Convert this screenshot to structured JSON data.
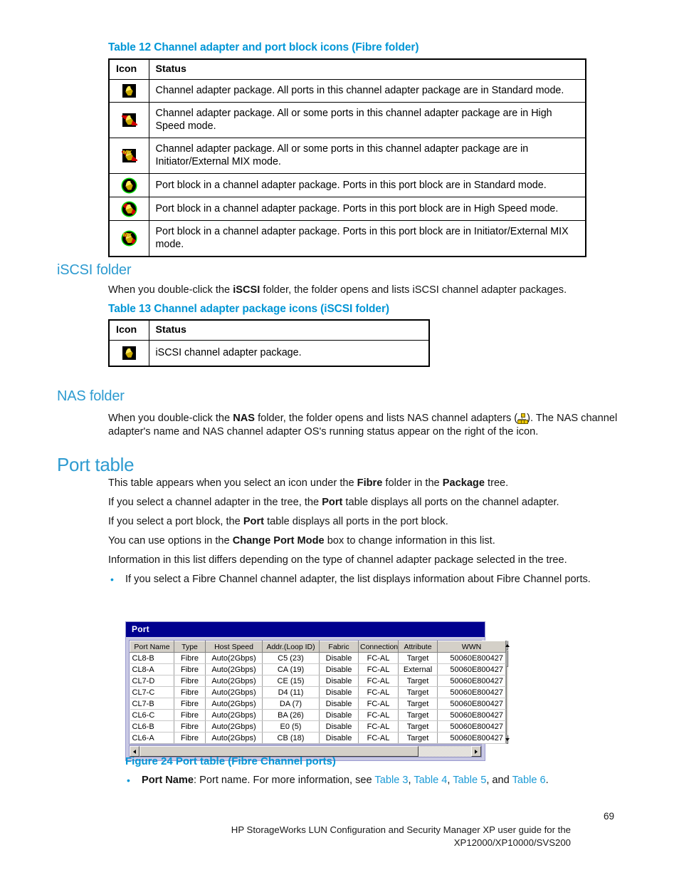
{
  "page": {
    "number": "69",
    "footer_line1": "HP StorageWorks LUN Configuration and Security Manager XP user guide for the",
    "footer_line2": "XP12000/XP10000/SVS200"
  },
  "table12": {
    "caption": "Table 12 Channel adapter and port block icons (Fibre folder)",
    "headers": [
      "Icon",
      "Status"
    ],
    "rows": [
      {
        "icon": "channel-adapter-standard-icon",
        "status": "Channel adapter package.  All ports in this channel adapter package are in Standard mode."
      },
      {
        "icon": "channel-adapter-highspeed-icon",
        "status": "Channel adapter package.  All or some ports in this channel adapter package are in High Speed mode."
      },
      {
        "icon": "channel-adapter-mix-icon",
        "status": "Channel adapter package.  All or some ports in this channel adapter package are in Initiator/External MIX mode."
      },
      {
        "icon": "port-block-standard-icon",
        "status": "Port block in a channel adapter package.  Ports in this port block are in Standard mode."
      },
      {
        "icon": "port-block-highspeed-icon",
        "status": "Port block in a channel adapter package.  Ports in this port block are in High Speed mode."
      },
      {
        "icon": "port-block-mix-icon",
        "status": "Port block in a channel adapter package.  Ports in this port block are in Initiator/External MIX mode."
      }
    ]
  },
  "iscsi_section": {
    "heading": "iSCSI folder",
    "intro_a": "When you double-click the ",
    "intro_b": "iSCSI",
    "intro_c": " folder, the folder opens and lists iSCSI channel adapter packages."
  },
  "table13": {
    "caption_a": "Table 13 Channel adapter package icons (",
    "caption_b": "iSCSI",
    "caption_c": " folder)",
    "headers": [
      "Icon",
      "Status"
    ],
    "rows": [
      {
        "icon": "iscsi-channel-adapter-icon",
        "status": "iSCSI channel adapter package."
      }
    ]
  },
  "nas_section": {
    "heading": "NAS folder",
    "line1_a": "When you double-click the ",
    "line1_b": "NAS",
    "line1_c": " folder, the folder opens and lists NAS channel adapters (",
    "line1_d": "). The NAS",
    "line2": "channel adapter's name and NAS channel adapter OS's running status appear on the right of the icon."
  },
  "port_table_section": {
    "heading": "Port table",
    "paragraphs": [
      {
        "parts": [
          {
            "t": "This table appears when you select an icon under the ",
            "b": false
          },
          {
            "t": "Fibre",
            "b": true
          },
          {
            "t": " folder in the ",
            "b": false
          },
          {
            "t": "Package",
            "b": true
          },
          {
            "t": " tree.",
            "b": false
          }
        ]
      },
      {
        "parts": [
          {
            "t": "If you select a channel adapter in the tree, the ",
            "b": false
          },
          {
            "t": "Port",
            "b": true
          },
          {
            "t": " table displays all ports on the channel adapter.",
            "b": false
          }
        ]
      },
      {
        "parts": [
          {
            "t": "If you select a port block, the ",
            "b": false
          },
          {
            "t": "Port",
            "b": true
          },
          {
            "t": " table displays all ports in the port block.",
            "b": false
          }
        ]
      },
      {
        "parts": [
          {
            "t": "You can use options in the ",
            "b": false
          },
          {
            "t": "Change Port Mode",
            "b": true
          },
          {
            "t": " box to change information in this list.",
            "b": false
          }
        ]
      },
      {
        "parts": [
          {
            "t": "Information in this list differs depending on the type of channel adapter package selected in the tree.",
            "b": false
          }
        ]
      }
    ],
    "bullet1_line1": "If you select a Fibre Channel channel adapter, the list displays information about Fibre Channel",
    "bullet1_line2": "ports."
  },
  "port_window": {
    "title": "Port",
    "columns": [
      "Port Name",
      "Type",
      "Host Speed",
      "Addr.(Loop ID)",
      "Fabric",
      "Connection",
      "Attribute",
      "WWN"
    ],
    "rows": [
      [
        "CL8-B",
        "Fibre",
        "Auto(2Gbps)",
        "C5 (23)",
        "Disable",
        "FC-AL",
        "Target",
        "50060E800427"
      ],
      [
        "CL8-A",
        "Fibre",
        "Auto(2Gbps)",
        "CA (19)",
        "Disable",
        "FC-AL",
        "External",
        "50060E800427"
      ],
      [
        "CL7-D",
        "Fibre",
        "Auto(2Gbps)",
        "CE (15)",
        "Disable",
        "FC-AL",
        "Target",
        "50060E800427"
      ],
      [
        "CL7-C",
        "Fibre",
        "Auto(2Gbps)",
        "D4 (11)",
        "Disable",
        "FC-AL",
        "Target",
        "50060E800427"
      ],
      [
        "CL7-B",
        "Fibre",
        "Auto(2Gbps)",
        "DA (7)",
        "Disable",
        "FC-AL",
        "Target",
        "50060E800427"
      ],
      [
        "CL6-C",
        "Fibre",
        "Auto(2Gbps)",
        "BA (26)",
        "Disable",
        "FC-AL",
        "Target",
        "50060E800427"
      ],
      [
        "CL6-B",
        "Fibre",
        "Auto(2Gbps)",
        "E0 (5)",
        "Disable",
        "FC-AL",
        "Target",
        "50060E800427"
      ],
      [
        "CL6-A",
        "Fibre",
        "Auto(2Gbps)",
        "CB (18)",
        "Disable",
        "FC-AL",
        "Target",
        "50060E800427"
      ]
    ]
  },
  "figure24": {
    "caption": "Figure 24 Port table (Fibre Channel ports)",
    "bullet": {
      "label": "Port Name",
      "text_a": ": Port name. For more information, see ",
      "xref1": "Table 3",
      "sep1": ", ",
      "xref2": "Table 4",
      "sep2": ", ",
      "xref3": "Table 5",
      "sep3": ", and ",
      "xref4": "Table 6",
      "end": "."
    }
  },
  "colors": {
    "heading_blue": "#2e9bd0",
    "caption_blue": "#0096d6",
    "titlebar_blue": "#00008f",
    "window_border": "#9a9ad0"
  }
}
